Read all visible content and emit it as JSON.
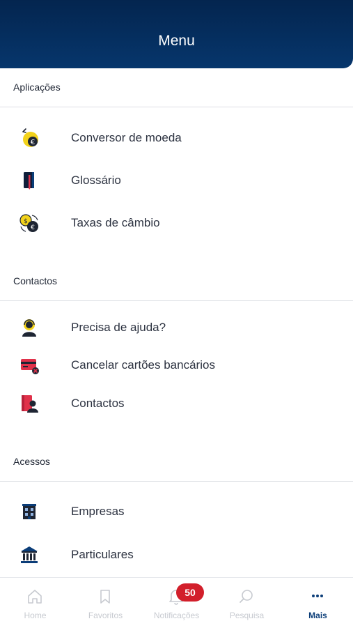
{
  "header": {
    "title": "Menu"
  },
  "sections": [
    {
      "title": "Aplicações",
      "items": [
        {
          "label": "Conversor de moeda",
          "icon": "currency-converter-icon"
        },
        {
          "label": "Glossário",
          "icon": "glossary-book-icon"
        },
        {
          "label": "Taxas de câmbio",
          "icon": "exchange-rates-icon"
        }
      ]
    },
    {
      "title": "Contactos",
      "items": [
        {
          "label": "Precisa de ajuda?",
          "icon": "support-agent-icon"
        },
        {
          "label": "Cancelar cartões bancários",
          "icon": "cancel-card-icon"
        },
        {
          "label": "Contactos",
          "icon": "contacts-icon"
        }
      ]
    },
    {
      "title": "Acessos",
      "items": [
        {
          "label": "Empresas",
          "icon": "company-building-icon"
        },
        {
          "label": "Particulares",
          "icon": "bank-icon"
        }
      ]
    }
  ],
  "tabbar": {
    "tabs": [
      {
        "label": "Home",
        "icon": "home-icon"
      },
      {
        "label": "Favoritos",
        "icon": "bookmark-icon"
      },
      {
        "label": "Notificações",
        "icon": "bell-icon",
        "badge": "50"
      },
      {
        "label": "Pesquisa",
        "icon": "search-icon"
      },
      {
        "label": "Mais",
        "icon": "more-icon"
      }
    ],
    "active": "Mais"
  },
  "colors": {
    "header": "#04254f",
    "accent_navy": "#0b3d78",
    "icon_yellow": "#f2d21b",
    "icon_red": "#e0314a",
    "badge_red": "#d21f2b"
  }
}
